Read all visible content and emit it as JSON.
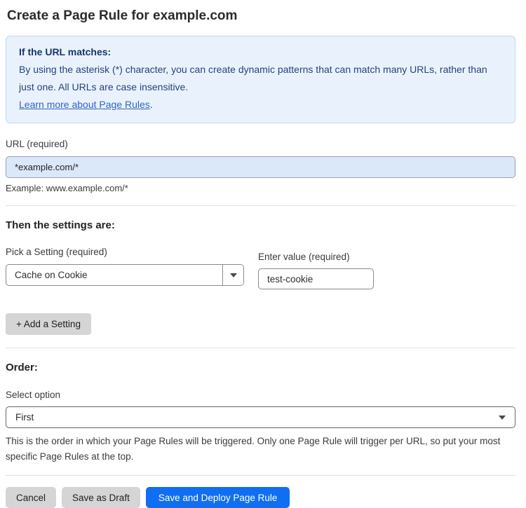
{
  "page": {
    "title": "Create a Page Rule for example.com"
  },
  "info_box": {
    "heading": "If the URL matches:",
    "body": "By using the asterisk (*) character, you can create dynamic patterns that can match many URLs, rather than just one. All URLs are case insensitive.",
    "link_label": "Learn more about Page Rules",
    "link_suffix": "."
  },
  "url_section": {
    "label": "URL (required)",
    "value": "*example.com/*",
    "helper": "Example: www.example.com/*"
  },
  "settings_section": {
    "heading": "Then the settings are:",
    "setting_label": "Pick a Setting (required)",
    "setting_value": "Cache on Cookie",
    "value_label": "Enter value (required)",
    "value": "test-cookie",
    "add_setting_label": "+ Add a Setting"
  },
  "order_section": {
    "heading": "Order:",
    "select_label": "Select option",
    "selected_option": "First",
    "helper": "This is the order in which your Page Rules will be triggered. Only one Page Rule will trigger per URL, so put your most specific Page Rules at the top."
  },
  "footer": {
    "cancel_label": "Cancel",
    "save_draft_label": "Save as Draft",
    "save_deploy_label": "Save and Deploy Page Rule"
  },
  "icons": {
    "setting_dropdown": "caret-down-icon",
    "order_dropdown": "caret-down-icon"
  },
  "colors": {
    "accent_blue": "#106ef2",
    "info_box_bg": "#e9f2fc",
    "info_box_border": "#bdd7f1",
    "info_text": "#27417a",
    "link_blue": "#2e64ca",
    "url_input_bg": "#dbe8fa",
    "gray_button_bg": "#d5d5d5"
  }
}
